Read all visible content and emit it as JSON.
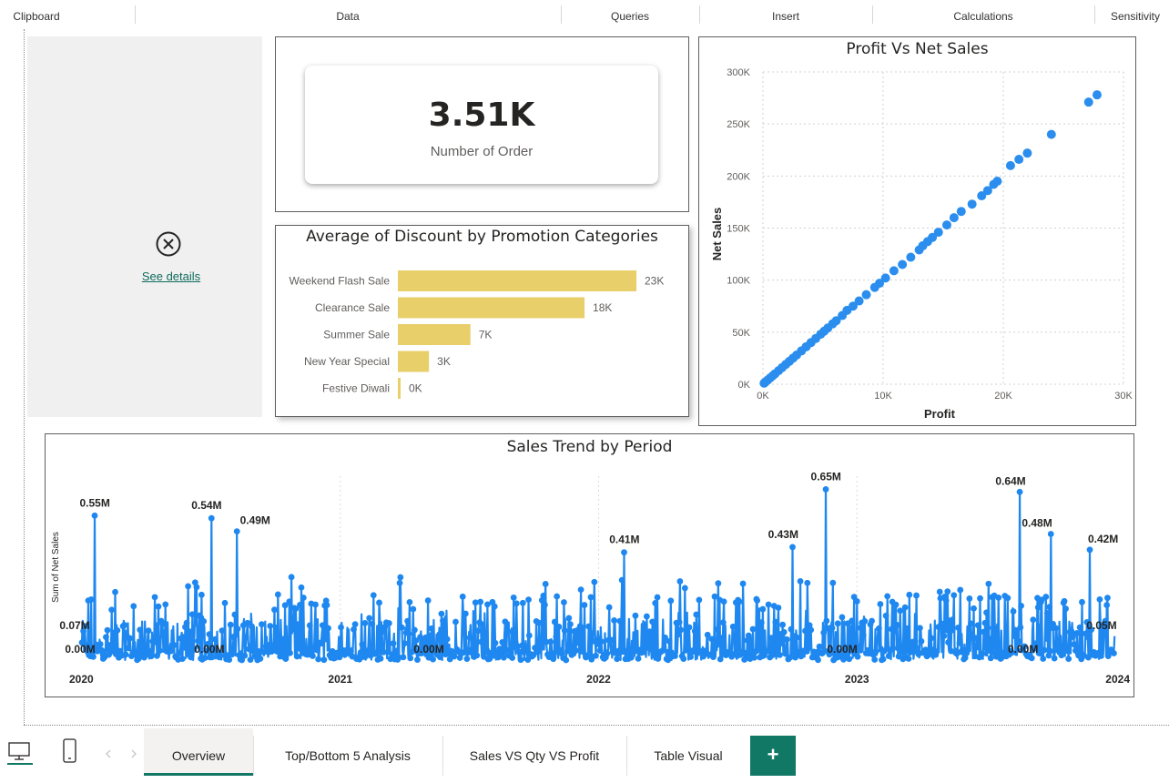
{
  "ribbon": {
    "groups": [
      "Clipboard",
      "Data",
      "Queries",
      "Insert",
      "Calculations",
      "Sensitivity"
    ]
  },
  "error_visual": {
    "icon": "error-circle-x-icon",
    "link_label": "See details"
  },
  "card": {
    "value": "3.51K",
    "label": "Number of Order"
  },
  "bar_chart": {
    "title": "Average of Discount by Promotion Categories",
    "bar_color": "#E8CF6A"
  },
  "scatter_chart": {
    "title": "Profit Vs Net Sales",
    "xlabel": "Profit",
    "ylabel": "Net Sales",
    "xticks": [
      "0K",
      "10K",
      "20K",
      "30K"
    ],
    "yticks": [
      "0K",
      "50K",
      "100K",
      "150K",
      "200K",
      "250K",
      "300K"
    ],
    "color": "#2B8EEE"
  },
  "line_chart": {
    "title": "Sales Trend by Period",
    "ylabel": "Sum of Net Sales",
    "xticks": [
      "2020",
      "2021",
      "2022",
      "2023",
      "2024"
    ],
    "color": "#1E88F0",
    "annotations": [
      "0.55M",
      "0.54M",
      "0.49M",
      "0.41M",
      "0.43M",
      "0.65M",
      "0.64M",
      "0.48M",
      "0.42M",
      "0.07M",
      "0.00M",
      "0.00M",
      "0.00M",
      "0.00M",
      "0.00M",
      "0.05M"
    ]
  },
  "chart_data": [
    {
      "type": "bar",
      "title": "Average of Discount by Promotion Categories",
      "categories": [
        "Weekend Flash Sale",
        "Clearance Sale",
        "Summer Sale",
        "New Year Special",
        "Festive Diwali"
      ],
      "values": [
        23,
        18,
        7,
        3,
        0.15
      ],
      "data_labels": [
        "23K",
        "18K",
        "7K",
        "3K",
        "0K"
      ],
      "unit": "K",
      "orientation": "horizontal"
    },
    {
      "type": "scatter",
      "title": "Profit Vs Net Sales",
      "xlabel": "Profit",
      "ylabel": "Net Sales",
      "xlim": [
        0,
        30000
      ],
      "ylim": [
        0,
        300000
      ],
      "grid": true,
      "points": [
        [
          27800,
          278000
        ],
        [
          27100,
          271000
        ],
        [
          24000,
          240000
        ],
        [
          22000,
          222000
        ],
        [
          21300,
          216000
        ],
        [
          20600,
          210000
        ],
        [
          19500,
          195000
        ],
        [
          19200,
          192000
        ],
        [
          18700,
          186000
        ],
        [
          18200,
          181000
        ],
        [
          17400,
          173000
        ],
        [
          16500,
          166000
        ],
        [
          15900,
          160000
        ],
        [
          15300,
          153000
        ],
        [
          14600,
          146000
        ],
        [
          14100,
          141000
        ],
        [
          13700,
          137000
        ],
        [
          13300,
          133000
        ],
        [
          13000,
          129000
        ],
        [
          12300,
          122000
        ],
        [
          11600,
          115000
        ],
        [
          10900,
          109000
        ],
        [
          10200,
          102000
        ],
        [
          9700,
          97000
        ],
        [
          9300,
          93000
        ],
        [
          8600,
          86000
        ],
        [
          8000,
          80000
        ],
        [
          7500,
          75000
        ],
        [
          7000,
          71000
        ],
        [
          6600,
          66000
        ],
        [
          6100,
          61000
        ],
        [
          5800,
          58000
        ],
        [
          5400,
          54000
        ],
        [
          5100,
          51000
        ],
        [
          4800,
          48000
        ],
        [
          4400,
          44000
        ],
        [
          4000,
          40000
        ],
        [
          3600,
          36000
        ],
        [
          3200,
          32000
        ],
        [
          2800,
          28000
        ],
        [
          2500,
          25000
        ],
        [
          2200,
          22000
        ],
        [
          1900,
          19000
        ],
        [
          1600,
          16000
        ],
        [
          1300,
          13000
        ],
        [
          1000,
          10000
        ],
        [
          800,
          8000
        ],
        [
          600,
          6000
        ],
        [
          400,
          4000
        ],
        [
          200,
          2000
        ],
        [
          100,
          1000
        ]
      ]
    },
    {
      "type": "line",
      "title": "Sales Trend by Period",
      "ylabel": "Sum of Net Sales",
      "x_range": [
        "2020",
        "2024"
      ],
      "ylim": [
        0,
        0.7
      ],
      "unit": "M",
      "labeled_points": [
        {
          "x": 2020.05,
          "y": 0.55,
          "label": "0.55M"
        },
        {
          "x": 2020.5,
          "y": 0.54,
          "label": "0.54M"
        },
        {
          "x": 2020.6,
          "y": 0.49,
          "label": "0.49M"
        },
        {
          "x": 2022.1,
          "y": 0.41,
          "label": "0.41M"
        },
        {
          "x": 2022.75,
          "y": 0.43,
          "label": "0.43M"
        },
        {
          "x": 2022.88,
          "y": 0.65,
          "label": "0.65M"
        },
        {
          "x": 2023.63,
          "y": 0.64,
          "label": "0.64M"
        },
        {
          "x": 2023.75,
          "y": 0.48,
          "label": "0.48M"
        },
        {
          "x": 2023.9,
          "y": 0.42,
          "label": "0.42M"
        },
        {
          "x": 2020.0,
          "y": 0.07,
          "label": "0.07M"
        },
        {
          "x": 2020.0,
          "y": 0.0,
          "label": "0.00M"
        },
        {
          "x": 2020.5,
          "y": 0.0,
          "label": "0.00M"
        },
        {
          "x": 2021.35,
          "y": 0.0,
          "label": "0.00M"
        },
        {
          "x": 2022.95,
          "y": 0.0,
          "label": "0.00M"
        },
        {
          "x": 2023.65,
          "y": 0.0,
          "label": "0.00M"
        },
        {
          "x": 2024.0,
          "y": 0.05,
          "label": "0.05M"
        }
      ]
    }
  ],
  "tabs": {
    "items": [
      "Overview",
      "Top/Bottom 5 Analysis",
      "Sales VS Qty VS Profit",
      "Table Visual"
    ],
    "active": "Overview",
    "add_label": "+"
  }
}
